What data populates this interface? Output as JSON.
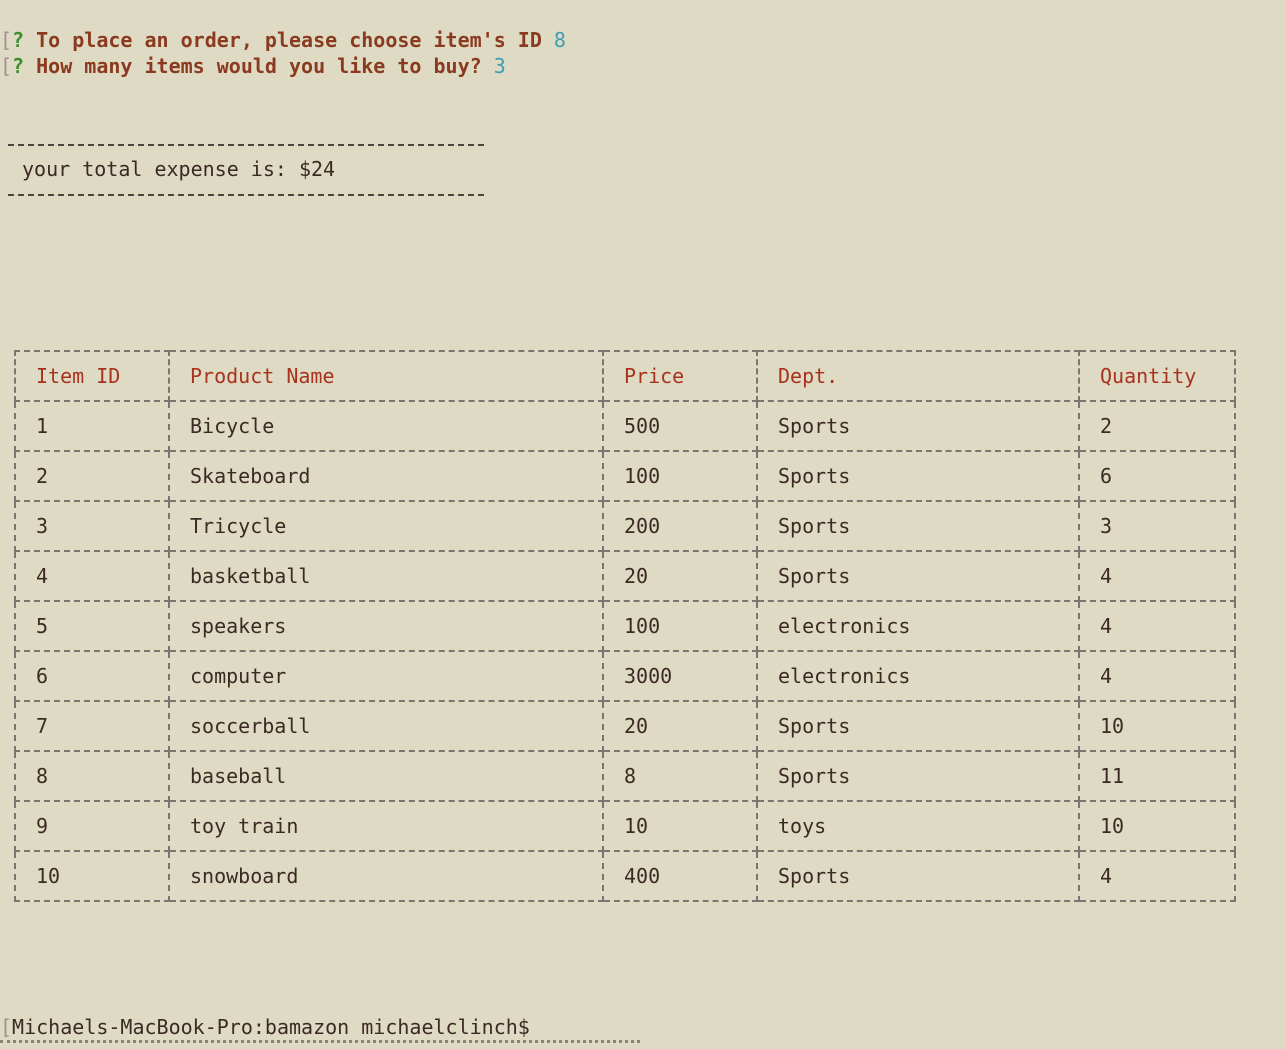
{
  "terminal": {
    "prompts": [
      {
        "bracket": "[",
        "marker": "?",
        "question": "To place an order, please choose item's ID",
        "answer": "8"
      },
      {
        "bracket": "[",
        "marker": "?",
        "question": "How many items would you like to buy?",
        "answer": "3"
      }
    ],
    "expense_text": "your total expense is: $24",
    "shell_bracket": "[",
    "shell_prompt": "Michaels-MacBook-Pro:bamazon michaelclinch$"
  },
  "table": {
    "headers": [
      "Item ID",
      "Product Name",
      "Price",
      "Dept.",
      "Quantity"
    ],
    "rows": [
      [
        "1",
        "Bicycle",
        "500",
        "Sports",
        "2"
      ],
      [
        "2",
        "Skateboard",
        "100",
        "Sports",
        "6"
      ],
      [
        "3",
        "Tricycle",
        "200",
        "Sports",
        "3"
      ],
      [
        "4",
        "basketball",
        "20",
        "Sports",
        "4"
      ],
      [
        "5",
        "speakers",
        "100",
        "electronics",
        "4"
      ],
      [
        "6",
        "computer",
        "3000",
        "electronics",
        "4"
      ],
      [
        "7",
        "soccerball",
        "20",
        "Sports",
        "10"
      ],
      [
        "8",
        "baseball",
        "8",
        "Sports",
        "11"
      ],
      [
        "9",
        "toy train",
        "10",
        "toys",
        "10"
      ],
      [
        "10",
        "snowboard",
        "400",
        "Sports",
        "4"
      ]
    ]
  },
  "colors": {
    "background": "#dfdac4",
    "prompt_text": "#8a3a1f",
    "prompt_marker": "#3b8f2a",
    "answer_text": "#3e9fb1",
    "header_text": "#a8321d",
    "body_text": "#3b2a23"
  }
}
